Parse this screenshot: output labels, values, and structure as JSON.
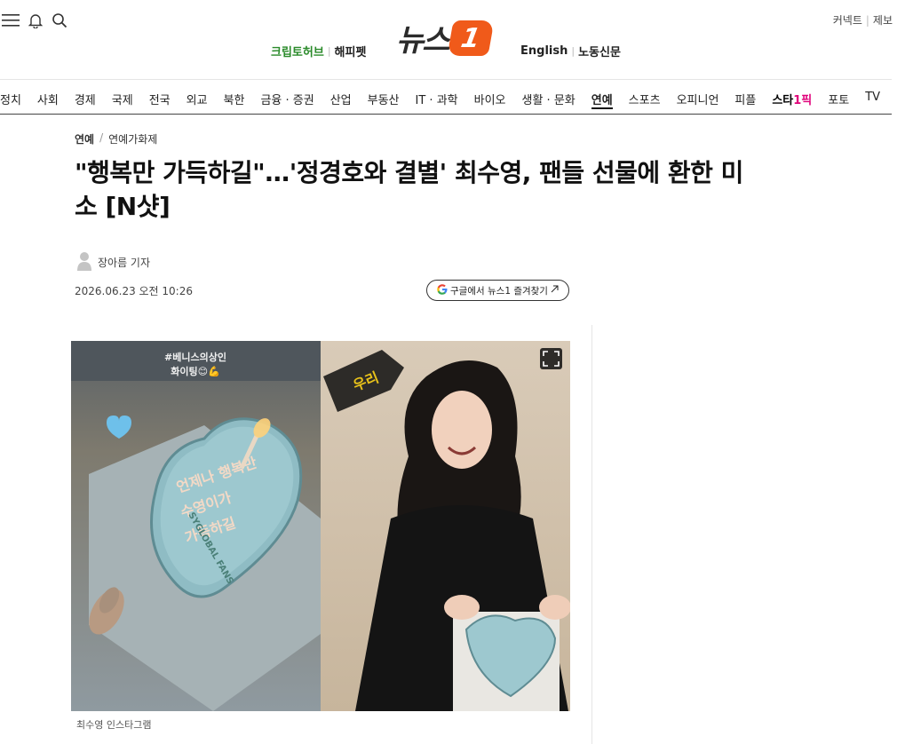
{
  "header": {
    "logo_text": "뉴스",
    "logo_badge": "1",
    "links_left": [
      "크립토허브",
      "해피펫"
    ],
    "links_right": [
      "English",
      "노동신문"
    ],
    "util_links": [
      "커넥트",
      "제보"
    ]
  },
  "nav": {
    "items": [
      "정치",
      "사회",
      "경제",
      "국제",
      "전국",
      "외교",
      "북한",
      "금융 · 증권",
      "산업",
      "부동산",
      "IT · 과학",
      "바이오",
      "생활 · 문화",
      "연예",
      "스포츠",
      "오피니언",
      "피플",
      "스타1픽",
      "포토",
      "TV"
    ],
    "active": "연예",
    "star_item": {
      "part1": "스타",
      "part2": "1픽"
    }
  },
  "article": {
    "breadcrumb": [
      "연예",
      "연예가화제"
    ],
    "title_line1": "\"행복만 가득하길\"…'정경호와 결별' 최수영, 팬들 선물에 환한 미",
    "title_line2": "소 [N샷]",
    "reporter": "장아름 기자",
    "date": "2026.06.23 오전 10:26",
    "google_button": "구글에서 뉴스1 즐겨찾기",
    "photo": {
      "left_overlay_line1": "#베니스의상인",
      "left_overlay_line2": "화이팅😊💪",
      "cake_text": [
        "언제나 행복만",
        "수영이가",
        "가득하길"
      ],
      "cake_rim": "SYGLOBAL FANS",
      "floor_sign": "우리"
    },
    "caption": "최수영 인스타그램"
  },
  "colors": {
    "logo_orange": "#f05a1a",
    "crypto_green": "#2a8a2a",
    "star_pink": "#e0007a"
  }
}
